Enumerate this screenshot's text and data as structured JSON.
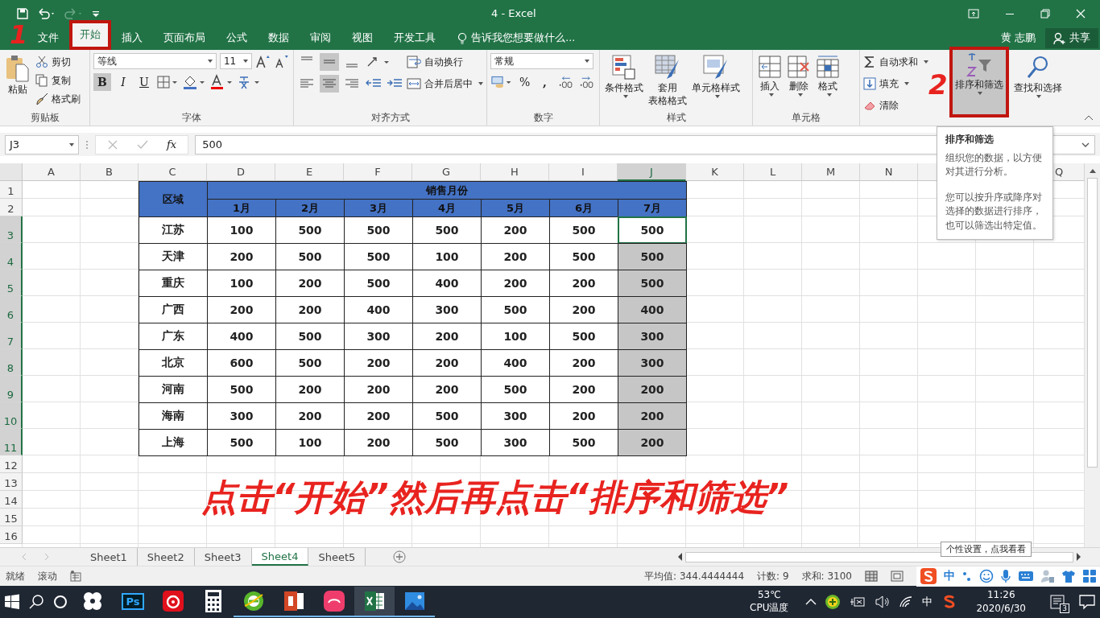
{
  "title_bar": {
    "title": "4 - Excel"
  },
  "menu_tabs": [
    {
      "label": "文件",
      "selected": false
    },
    {
      "label": "开始",
      "selected": true
    },
    {
      "label": "插入",
      "selected": false
    },
    {
      "label": "页面布局",
      "selected": false
    },
    {
      "label": "公式",
      "selected": false
    },
    {
      "label": "数据",
      "selected": false
    },
    {
      "label": "审阅",
      "selected": false
    },
    {
      "label": "视图",
      "selected": false
    },
    {
      "label": "开发工具",
      "selected": false
    }
  ],
  "tell_me": "告诉我您想要做什么...",
  "user": "黄 志鹏",
  "share": "共享",
  "ribbon": {
    "clipboard": {
      "paste": "粘贴",
      "cut": "剪切",
      "copy": "复制",
      "painter": "格式刷",
      "label": "剪贴板"
    },
    "font": {
      "name": "等线",
      "size": "11",
      "bold": "B",
      "italic": "I",
      "underline": "U",
      "bold_on": true,
      "label": "字体"
    },
    "alignment": {
      "v_align": [
        {
          "selected": false
        },
        {
          "selected": true
        },
        {
          "selected": false
        }
      ],
      "h_align": [
        {
          "selected": false
        },
        {
          "selected": true
        },
        {
          "selected": false
        }
      ],
      "wrap": "自动换行",
      "merge": "合并后居中",
      "label": "对齐方式"
    },
    "number": {
      "format": "常规",
      "percent": "%",
      "comma": ",",
      "label": "数字"
    },
    "styles": {
      "conditional": "条件格式",
      "table_format_1": "套用",
      "table_format_2": "表格格式",
      "cell_styles": "单元格样式",
      "label": "样式"
    },
    "cells": {
      "insert": "插入",
      "delete": "删除",
      "format": "格式",
      "label": "单元格"
    },
    "editing": {
      "autosum": "自动求和",
      "fill": "填充",
      "clear": "清除",
      "sort_filter": "排序和筛选",
      "sort_highlighted": true,
      "find": "查找和选择"
    }
  },
  "formula_bar": {
    "name_box": "J3",
    "fx": "fx",
    "value": "500"
  },
  "columns": [
    {
      "label": "A",
      "selected": false
    },
    {
      "label": "B",
      "selected": false
    },
    {
      "label": "C",
      "selected": false
    },
    {
      "label": "D",
      "selected": false
    },
    {
      "label": "E",
      "selected": false
    },
    {
      "label": "F",
      "selected": false
    },
    {
      "label": "G",
      "selected": false
    },
    {
      "label": "H",
      "selected": false
    },
    {
      "label": "I",
      "selected": false
    },
    {
      "label": "J",
      "selected": true
    },
    {
      "label": "K",
      "selected": false
    },
    {
      "label": "L",
      "selected": false
    },
    {
      "label": "M",
      "selected": false
    },
    {
      "label": "N",
      "selected": false
    },
    {
      "selected": false
    },
    {},
    {
      "label": "Q",
      "selected": false
    }
  ],
  "rows": [
    {
      "label": "1",
      "selected": false
    },
    {
      "label": "2",
      "selected": false
    },
    {
      "label": "3",
      "selected": true
    },
    {
      "label": "4",
      "selected": true
    },
    {
      "label": "5",
      "selected": true
    },
    {
      "label": "6",
      "selected": true
    },
    {
      "label": "7",
      "selected": true
    },
    {
      "label": "8",
      "selected": true
    },
    {
      "label": "9",
      "selected": true
    },
    {
      "label": "10",
      "selected": true
    },
    {
      "label": "11",
      "selected": true
    },
    {
      "label": "12",
      "selected": false
    },
    {
      "label": "13",
      "selected": false
    },
    {
      "label": "14",
      "selected": false
    },
    {
      "label": "15",
      "selected": false
    },
    {
      "label": "16",
      "selected": false
    }
  ],
  "table": {
    "region_header": "区域",
    "group_header": "销售月份",
    "months": [
      "1月",
      "2月",
      "3月",
      "4月",
      "5月",
      "6月",
      "7月"
    ],
    "rows": [
      {
        "region": "江苏",
        "values": [
          {
            "text": "100",
            "selected": false,
            "active": false
          },
          {
            "text": "500",
            "selected": false,
            "active": false
          },
          {
            "text": "500",
            "selected": false,
            "active": false
          },
          {
            "text": "500",
            "selected": false,
            "active": false
          },
          {
            "text": "200",
            "selected": false,
            "active": false
          },
          {
            "text": "500",
            "selected": false,
            "active": false
          },
          {
            "text": "500",
            "selected": false,
            "active": true
          }
        ]
      },
      {
        "region": "天津",
        "values": [
          {
            "text": "200",
            "selected": false,
            "active": false
          },
          {
            "text": "500",
            "selected": false,
            "active": false
          },
          {
            "text": "500",
            "selected": false,
            "active": false
          },
          {
            "text": "100",
            "selected": false,
            "active": false
          },
          {
            "text": "200",
            "selected": false,
            "active": false
          },
          {
            "text": "500",
            "selected": false,
            "active": false
          },
          {
            "text": "500",
            "selected": true,
            "active": false
          }
        ]
      },
      {
        "region": "重庆",
        "values": [
          {
            "text": "100",
            "selected": false,
            "active": false
          },
          {
            "text": "200",
            "selected": false,
            "active": false
          },
          {
            "text": "500",
            "selected": false,
            "active": false
          },
          {
            "text": "400",
            "selected": false,
            "active": false
          },
          {
            "text": "200",
            "selected": false,
            "active": false
          },
          {
            "text": "200",
            "selected": false,
            "active": false
          },
          {
            "text": "500",
            "selected": true,
            "active": false
          }
        ]
      },
      {
        "region": "广西",
        "values": [
          {
            "text": "200",
            "selected": false,
            "active": false
          },
          {
            "text": "200",
            "selected": false,
            "active": false
          },
          {
            "text": "400",
            "selected": false,
            "active": false
          },
          {
            "text": "300",
            "selected": false,
            "active": false
          },
          {
            "text": "500",
            "selected": false,
            "active": false
          },
          {
            "text": "200",
            "selected": false,
            "active": false
          },
          {
            "text": "400",
            "selected": true,
            "active": false
          }
        ]
      },
      {
        "region": "广东",
        "values": [
          {
            "text": "400",
            "selected": false,
            "active": false
          },
          {
            "text": "500",
            "selected": false,
            "active": false
          },
          {
            "text": "300",
            "selected": false,
            "active": false
          },
          {
            "text": "200",
            "selected": false,
            "active": false
          },
          {
            "text": "100",
            "selected": false,
            "active": false
          },
          {
            "text": "500",
            "selected": false,
            "active": false
          },
          {
            "text": "300",
            "selected": true,
            "active": false
          }
        ]
      },
      {
        "region": "北京",
        "values": [
          {
            "text": "600",
            "selected": false,
            "active": false
          },
          {
            "text": "500",
            "selected": false,
            "active": false
          },
          {
            "text": "200",
            "selected": false,
            "active": false
          },
          {
            "text": "200",
            "selected": false,
            "active": false
          },
          {
            "text": "400",
            "selected": false,
            "active": false
          },
          {
            "text": "200",
            "selected": false,
            "active": false
          },
          {
            "text": "300",
            "selected": true,
            "active": false
          }
        ]
      },
      {
        "region": "河南",
        "values": [
          {
            "text": "500",
            "selected": false,
            "active": false
          },
          {
            "text": "200",
            "selected": false,
            "active": false
          },
          {
            "text": "200",
            "selected": false,
            "active": false
          },
          {
            "text": "200",
            "selected": false,
            "active": false
          },
          {
            "text": "500",
            "selected": false,
            "active": false
          },
          {
            "text": "200",
            "selected": false,
            "active": false
          },
          {
            "text": "200",
            "selected": true,
            "active": false
          }
        ]
      },
      {
        "region": "海南",
        "values": [
          {
            "text": "300",
            "selected": false,
            "active": false
          },
          {
            "text": "200",
            "selected": false,
            "active": false
          },
          {
            "text": "200",
            "selected": false,
            "active": false
          },
          {
            "text": "500",
            "selected": false,
            "active": false
          },
          {
            "text": "300",
            "selected": false,
            "active": false
          },
          {
            "text": "200",
            "selected": false,
            "active": false
          },
          {
            "text": "200",
            "selected": true,
            "active": false
          }
        ]
      },
      {
        "region": "上海",
        "values": [
          {
            "text": "500",
            "selected": false,
            "active": false
          },
          {
            "text": "100",
            "selected": false,
            "active": false
          },
          {
            "text": "200",
            "selected": false,
            "active": false
          },
          {
            "text": "500",
            "selected": false,
            "active": false
          },
          {
            "text": "300",
            "selected": false,
            "active": false
          },
          {
            "text": "500",
            "selected": false,
            "active": false
          },
          {
            "text": "200",
            "selected": true,
            "active": false
          }
        ]
      }
    ]
  },
  "tooltip": {
    "title": "排序和筛选",
    "paragraphs": [
      "组织您的数据，以方便对其进行分析。",
      "您可以按升序或降序对选择的数据进行排序，也可以筛选出特定值。"
    ]
  },
  "annotations": {
    "caption": "点击“开始”然后再点击“排序和筛选”",
    "steps": [
      "1",
      "2"
    ]
  },
  "sheet_tabs": [
    {
      "label": "Sheet1",
      "selected": false
    },
    {
      "label": "Sheet2",
      "selected": false
    },
    {
      "label": "Sheet3",
      "selected": false
    },
    {
      "label": "Sheet4",
      "selected": true
    },
    {
      "label": "Sheet5",
      "selected": false
    }
  ],
  "status_bar": {
    "mode": "就绪",
    "scroll": "滚动",
    "average": "平均值: 344.4444444",
    "count": "计数: 9",
    "sum": "求和: 3100"
  },
  "ime_hint": "个性设置，点我看看",
  "ime_bar": {
    "mode": "中"
  },
  "taskbar": {
    "apps": [
      {
        "kind": "pinwheel",
        "running": false,
        "selected": false
      },
      {
        "kind": "photoshop",
        "label": "Ps",
        "running": false,
        "selected": false
      },
      {
        "kind": "music",
        "running": false,
        "selected": false
      },
      {
        "kind": "calculator",
        "running": false,
        "selected": false
      },
      {
        "kind": "browser",
        "running": true,
        "selected": false
      },
      {
        "kind": "powerpoint",
        "running": true,
        "selected": false
      },
      {
        "kind": "camera",
        "running": true,
        "selected": false
      },
      {
        "kind": "excel",
        "running": true,
        "selected": true
      },
      {
        "kind": "photos",
        "running": true,
        "selected": false
      }
    ],
    "temperature": "53℃",
    "temperature_label": "CPU温度",
    "ime": "中",
    "time": "11:26",
    "date": "2020/6/30",
    "notifications": "3"
  }
}
